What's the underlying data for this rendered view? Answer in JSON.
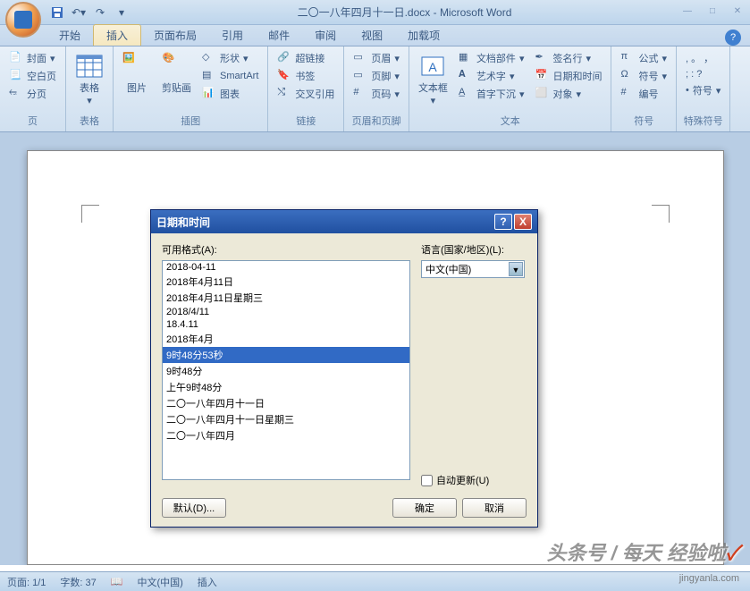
{
  "title": "二〇一八年四月十一日.docx - Microsoft Word",
  "tabs": [
    "开始",
    "插入",
    "页面布局",
    "引用",
    "邮件",
    "审阅",
    "视图",
    "加载项"
  ],
  "active_tab": "插入",
  "ribbon": {
    "pages": {
      "label": "页",
      "items": [
        "封面",
        "空白页",
        "分页"
      ]
    },
    "tables": {
      "label": "表格",
      "btn": "表格"
    },
    "illustrations": {
      "label": "插图",
      "pic": "图片",
      "clip": "剪贴画",
      "shapes": "形状",
      "smartart": "SmartArt",
      "chart": "图表"
    },
    "links": {
      "label": "链接",
      "hyperlink": "超链接",
      "bookmark": "书签",
      "crossref": "交叉引用"
    },
    "headerfooter": {
      "label": "页眉和页脚",
      "header": "页眉",
      "footer": "页脚",
      "pagenum": "页码"
    },
    "text": {
      "label": "文本",
      "textbox": "文本框",
      "parts": "文档部件",
      "wordart": "艺术字",
      "dropcap": "首字下沉",
      "sigline": "签名行",
      "datetime": "日期和时间",
      "object": "对象"
    },
    "symbols": {
      "label": "符号",
      "equation": "公式",
      "symbol": "符号",
      "number": "编号"
    },
    "special": {
      "label": "特殊符号",
      "sym": "符号"
    }
  },
  "dialog": {
    "title": "日期和时间",
    "formats_label": "可用格式(A):",
    "language_label": "语言(国家/地区)(L):",
    "language": "中文(中国)",
    "formats": [
      "2018-04-11",
      "2018年4月11日",
      "2018年4月11日星期三",
      "2018/4/11",
      "18.4.11",
      "2018年4月",
      "9时48分53秒",
      "9时48分",
      "上午9时48分",
      "二〇一八年四月十一日",
      "二〇一八年四月十一日星期三",
      "二〇一八年四月"
    ],
    "selected_index": 6,
    "auto_update": "自动更新(U)",
    "default_btn": "默认(D)...",
    "ok_btn": "确定",
    "cancel_btn": "取消"
  },
  "statusbar": {
    "page": "页面: 1/1",
    "words": "字数: 37",
    "lang": "中文(中国)",
    "mode": "插入"
  },
  "watermark": {
    "brand": "经验啦",
    "byline": "头条号 / 每天",
    "url": "jingyanla.com"
  }
}
